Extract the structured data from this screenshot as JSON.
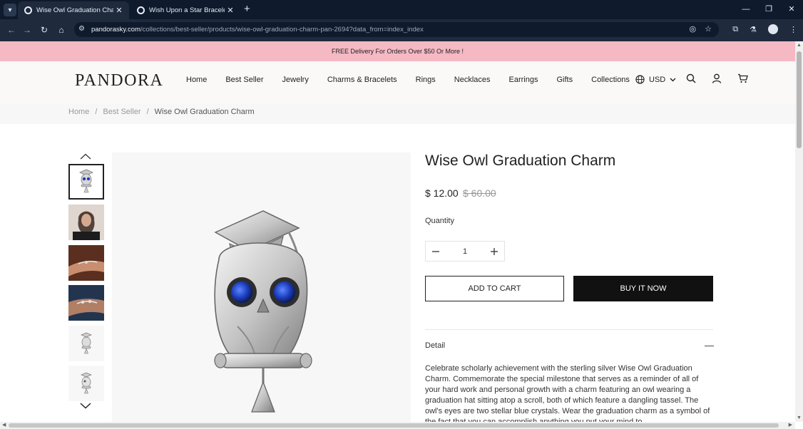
{
  "browser": {
    "tabs": [
      {
        "title": "Wise Owl Graduation Charm - P",
        "active": true
      },
      {
        "title": "Wish Upon a Star Bracelet Set",
        "active": false
      }
    ],
    "url_host": "pandorasky.com",
    "url_path": "/collections/best-seller/products/wise-owl-graduation-charm-pan-2694?data_from=index_index"
  },
  "announcement": "FREE Delivery For Orders Over $50 Or More !",
  "header": {
    "logo": "PANDORA",
    "nav": [
      "Home",
      "Best Seller",
      "Jewelry",
      "Charms & Bracelets",
      "Rings",
      "Necklaces",
      "Earrings",
      "Gifts",
      "Collections"
    ],
    "currency": "USD"
  },
  "breadcrumb": {
    "home": "Home",
    "collection": "Best Seller",
    "current": "Wise Owl Graduation Charm"
  },
  "product": {
    "title": "Wise Owl Graduation Charm",
    "price": "$ 12.00",
    "compare_price": "$ 60.00",
    "quantity_label": "Quantity",
    "quantity": "1",
    "add_to_cart": "ADD TO CART",
    "buy_now": "BUY IT NOW",
    "detail_title": "Detail",
    "detail_text": "Celebrate scholarly achievement with the sterling silver Wise Owl Graduation Charm. Commemorate the special milestone that serves as a reminder of all of your hard work and personal growth with a charm featuring an owl wearing a graduation hat sitting atop a scroll, both of which feature a dangling tassel. The owl's eyes are two stellar blue crystals. Wear the graduation charm as a symbol of the fact that you can accomplish anything you put your mind to."
  },
  "colors": {
    "announcement_bg": "#f5b9c4",
    "buy_button_bg": "#111111",
    "crystal_blue": "#1d3fbf"
  }
}
